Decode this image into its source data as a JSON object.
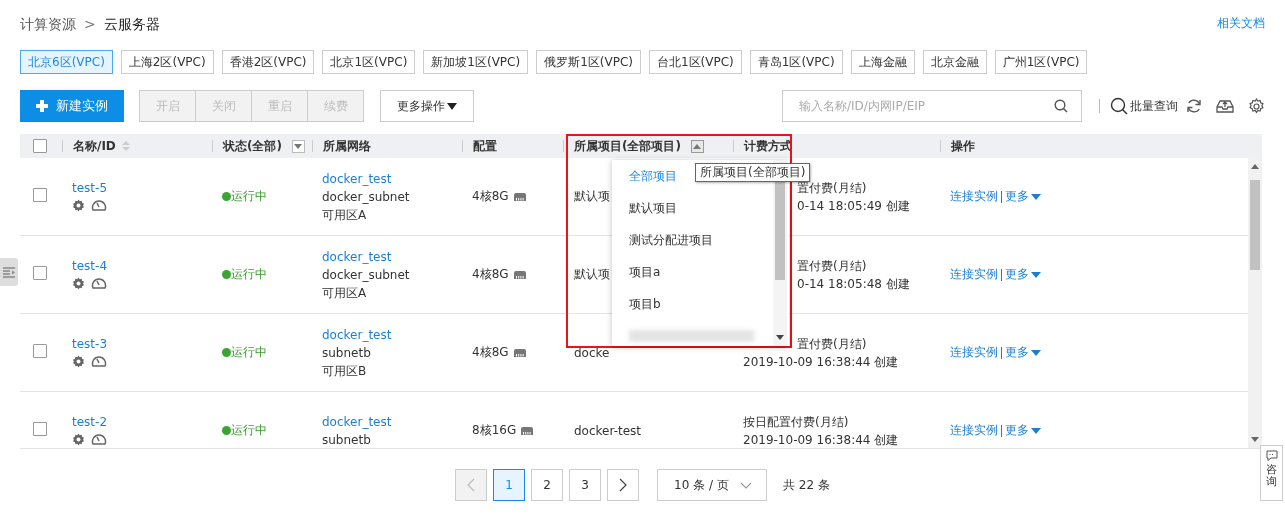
{
  "breadcrumb": {
    "parent": "计算资源",
    "separator": ">",
    "current": "云服务器"
  },
  "docs_link": "相关文档",
  "regions": [
    {
      "label": "北京6区(VPC)",
      "selected": true
    },
    {
      "label": "上海2区(VPC)",
      "selected": false
    },
    {
      "label": "香港2区(VPC)",
      "selected": false
    },
    {
      "label": "北京1区(VPC)",
      "selected": false
    },
    {
      "label": "新加坡1区(VPC)",
      "selected": false
    },
    {
      "label": "俄罗斯1区(VPC)",
      "selected": false
    },
    {
      "label": "台北1区(VPC)",
      "selected": false
    },
    {
      "label": "青岛1区(VPC)",
      "selected": false
    },
    {
      "label": "上海金融",
      "selected": false
    },
    {
      "label": "北京金融",
      "selected": false
    },
    {
      "label": "广州1区(VPC)",
      "selected": false
    }
  ],
  "toolbar": {
    "create_button": "新建实例",
    "actions": [
      {
        "label": "开启",
        "disabled": true
      },
      {
        "label": "关闭",
        "disabled": true
      },
      {
        "label": "重启",
        "disabled": true
      },
      {
        "label": "续费",
        "disabled": true
      }
    ],
    "more_button": "更多操作",
    "search": {
      "placeholder": "输入名称/ID/内网IP/EIP"
    },
    "batch_query": "批量查询"
  },
  "table": {
    "header_checkbox": {
      "checked": false
    },
    "columns": [
      {
        "label": "名称/ID",
        "kind": "sortable"
      },
      {
        "label": "状态(全部)",
        "kind": "filterable",
        "expanded": false
      },
      {
        "label": "所属网络",
        "kind": "plain"
      },
      {
        "label": "配置",
        "kind": "plain"
      },
      {
        "label": "所属项目(全部项目)",
        "kind": "filterable",
        "expanded": true
      },
      {
        "label": "计费方式",
        "kind": "plain"
      },
      {
        "label": "操作",
        "kind": "plain"
      }
    ],
    "rows": [
      {
        "checked": false,
        "name": "test-5",
        "status": "运行中",
        "network": [
          "docker_test",
          "docker_subnet",
          "可用区A"
        ],
        "config": "4核8G",
        "project": "默认项",
        "billing": [
          "置付费(月结)",
          "0-14 18:05:49 创建"
        ],
        "actions": [
          "连接实例",
          "更多"
        ]
      },
      {
        "checked": false,
        "name": "test-4",
        "status": "运行中",
        "network": [
          "docker_test",
          "docker_subnet",
          "可用区A"
        ],
        "config": "4核8G",
        "project": "默认项",
        "billing": [
          "置付费(月结)",
          "0-14 18:05:48 创建"
        ],
        "actions": [
          "连接实例",
          "更多"
        ]
      },
      {
        "checked": false,
        "name": "test-3",
        "status": "运行中",
        "network": [
          "docker_test",
          "subnetb",
          "可用区B"
        ],
        "config": "4核8G",
        "project": "docke",
        "billing": [
          "置付费(月结)",
          "2019-10-09 16:38:44 创建"
        ],
        "actions": [
          "连接实例",
          "更多"
        ]
      },
      {
        "checked": false,
        "name": "test-2",
        "status": "运行中",
        "network": [
          "docker_test",
          "subnetb"
        ],
        "config": "8核16G",
        "project": "docker-test",
        "billing": [
          "按日配置付费(月结)",
          "2019-10-09 16:38:44 创建"
        ],
        "actions": [
          "连接实例",
          "更多"
        ]
      }
    ],
    "dropdown": {
      "options": [
        {
          "label": "全部项目",
          "selected": true
        },
        {
          "label": "默认项目",
          "selected": false
        },
        {
          "label": "测试分配进项目",
          "selected": false
        },
        {
          "label": "项目a",
          "selected": false
        },
        {
          "label": "项目b",
          "selected": false
        }
      ],
      "tooltip": "所属项目(全部项目)"
    }
  },
  "pagination": {
    "prev": {
      "disabled": true
    },
    "next": {
      "disabled": false
    },
    "pages": [
      {
        "label": "1",
        "selected": true
      },
      {
        "label": "2",
        "selected": false
      },
      {
        "label": "3",
        "selected": false
      }
    ],
    "page_size": "10 条 / 页",
    "total": "共 22 条"
  },
  "consult": "咨询"
}
